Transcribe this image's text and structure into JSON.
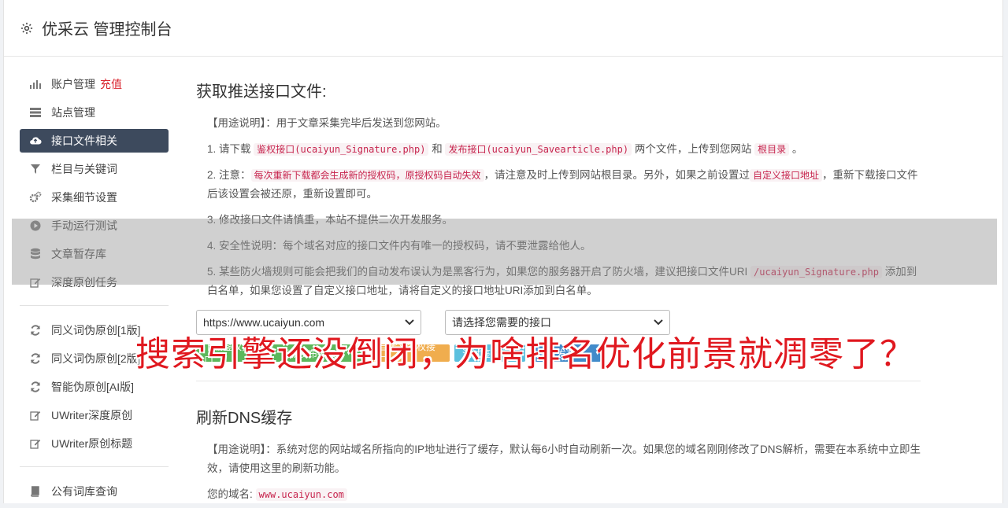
{
  "header": {
    "title": "优采云 管理控制台",
    "icon": "gear-icon"
  },
  "sidebar": {
    "items": [
      {
        "label": "账户管理",
        "badge": "充值",
        "icon": "bar-chart-icon",
        "active": false
      },
      {
        "label": "站点管理",
        "icon": "server-icon",
        "active": false
      },
      {
        "label": "接口文件相关",
        "icon": "cloud-upload-icon",
        "active": true
      },
      {
        "label": "栏目与关键词",
        "icon": "filter-icon",
        "active": false
      },
      {
        "label": "采集细节设置",
        "icon": "cogs-icon",
        "active": false
      },
      {
        "label": "手动运行测试",
        "icon": "play-icon",
        "active": false
      },
      {
        "label": "文章暂存库",
        "icon": "database-icon",
        "active": false
      },
      {
        "label": "深度原创任务",
        "icon": "edit-icon",
        "active": false
      },
      {
        "label": "同义词伪原创[1版]",
        "icon": "refresh-icon",
        "active": false
      },
      {
        "label": "同义词伪原创[2版]",
        "icon": "refresh-icon",
        "active": false
      },
      {
        "label": "智能伪原创[AI版]",
        "icon": "refresh-icon",
        "active": false
      },
      {
        "label": "UWriter深度原创",
        "icon": "edit-icon",
        "active": false
      },
      {
        "label": "UWriter原创标题",
        "icon": "edit-icon",
        "active": false
      },
      {
        "label": "公有词库查询",
        "icon": "book-icon",
        "active": false
      }
    ]
  },
  "main": {
    "section1_title": "获取推送接口文件:",
    "usage_label": "【用途说明】：用于文章采集完毕后发送到您网站。",
    "p1_a": "1. 请下载 ",
    "p1_code1": "鉴权接口(ucaiyun_Signature.php)",
    "p1_b": " 和 ",
    "p1_code2": "发布接口(ucaiyun_Savearticle.php)",
    "p1_c": " 两个文件，上传到您网站 ",
    "p1_code3": "根目录",
    "p1_d": " 。",
    "p2_a": "2. 注意：",
    "p2_code1": "每次重新下载都会生成新的授权码，原授权码自动失效",
    "p2_b": "，请注意及时上传到网站根目录。另外，如果之前设置过",
    "p2_code2": "自定义接口地址",
    "p2_c": "，重新下载接口文件后该设置会被还原，重新设置即可。",
    "p3": "3. 修改接口文件请慎重，本站不提供二次开发服务。",
    "p4": "4. 安全性说明：每个域名对应的接口文件内有唯一的授权码，请不要泄露给他人。",
    "p5_a": "5. 某些防火墙规则可能会把我们的自动发布误认为是黑客行为，如果您的服务器开启了防火墙，建议把接口文件URI ",
    "p5_code": "/ucaiyun_Signature.php",
    "p5_b": " 添加到白名单，如果您设置了自定义接口地址，请将自定义的接口地址URI添加到白名单。",
    "select_site": "https://www.ucaiyun.com",
    "select_iface": "请选择您需要的接口",
    "btn1": "下载鉴权接口",
    "btn2": "下载发布接口",
    "btn3": "自定义鉴权接口",
    "btn4": "测试鉴权",
    "btn5": "测试发布",
    "section2_title": "刷新DNS缓存",
    "dns_usage": "【用途说明】：系统对您的网站域名所指向的IP地址进行了缓存，默认每6小时自动刷新一次。如果您的域名刚刚修改了DNS解析，需要在本系统中立即生效，请使用这里的刷新功能。",
    "domain_label": "您的域名:",
    "domain_value": "www.ucaiyun.com"
  },
  "overlay": {
    "headline": "搜索引擎还没倒闭，为啥排名优化前景就凋零了？"
  },
  "colors": {
    "sidebar_active": "#3d4a5d",
    "code_text": "#c7254e",
    "headline": "#e0181f",
    "badge": "#d9232d"
  }
}
